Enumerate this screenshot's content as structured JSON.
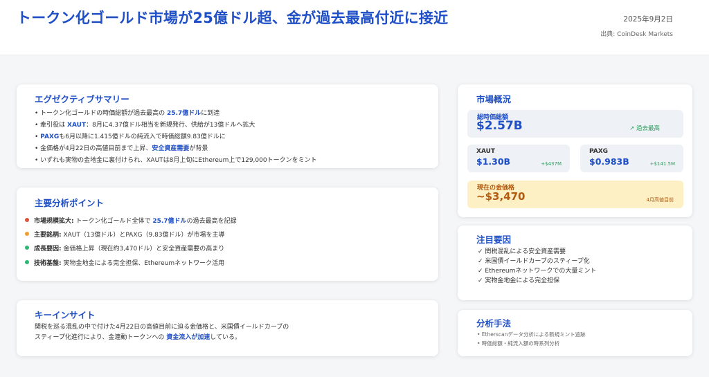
{
  "header": {
    "title": "トークン化ゴールド市場が25億ドル超、金が過去最高付近に接近",
    "date": "2025年9月2日",
    "source": "出典: CoinDesk Markets"
  },
  "summary": {
    "title": "エグゼクティブサマリー",
    "b1_pre": "• トークン化ゴールドの時価総額が過去最高の ",
    "b1_hl": "25.7億ドル",
    "b1_post": "に到達",
    "b2_pre": "• 牽引役は ",
    "b2_hl": "XAUT",
    "b2_post": "：8月に4.37億ドル相当を新規発行、供給が13億ドルへ拡大",
    "b3_pre": "• ",
    "b3_hl": "PAXG",
    "b3_post": "も6月以降に1.415億ドルの純流入で時価総額9.83億ドルに",
    "b4_pre": "• 金価格が4月22日の高値目前まで上昇、",
    "b4_hl": "安全資産需要",
    "b4_post": "が背景",
    "b5": "• いずれも実物の金地金に裏付けられ、XAUTは8月上旬にEthereum上で129,000トークンをミント"
  },
  "analysis": {
    "title": "主要分析ポイント",
    "p1_label": "市場規模拡大:",
    "p1_pre": " トークン化ゴールド全体で ",
    "p1_hl": "25.7億ドル",
    "p1_post": "の過去最高を記録",
    "p2_label": "主要銘柄:",
    "p2_text": " XAUT（13億ドル）とPAXG（9.83億ドル）が市場を主導",
    "p3_label": "成長要因:",
    "p3_text": " 金価格上昇（現在約3,470ドル）と安全資産需要の高まり",
    "p4_label": "技術基盤:",
    "p4_text": " 実物金地金による完全担保、Ethereumネットワーク活用",
    "dot_colors": [
      "#e0533c",
      "#f0a030",
      "#2eb872",
      "#2eb872"
    ]
  },
  "insight": {
    "title": "キーインサイト",
    "line1": "関税を巡る混乱の中で付けた4月22日の高値目前に迫る金価格と、米国債イールドカーブの",
    "line2_pre": "スティープ化進行により、金連動トークンへの ",
    "line2_hl": "資金流入が加速",
    "line2_post": "している。"
  },
  "market": {
    "title": "市場概況",
    "total_label": "総時価総額",
    "total_value": "$2.57B",
    "total_badge": "↗ 過去最高",
    "xaut_label": "XAUT",
    "xaut_value": "$1.30B",
    "xaut_change": "+$437M",
    "paxg_label": "PAXG",
    "paxg_value": "$0.983B",
    "paxg_change": "+$141.5M",
    "gold_label": "現在の金価格",
    "gold_value": "~$3,470",
    "gold_note": "4月高値目前"
  },
  "factors": {
    "title": "注目要因",
    "items": [
      "✓ 関税混乱による安全資産需要",
      "✓ 米国債イールドカーブのスティープ化",
      "✓ Ethereumネットワークでの大量ミント",
      "✓ 実物金地金による完全担保"
    ]
  },
  "method": {
    "title": "分析手法",
    "items": [
      "• Etherscanデータ分析による新規ミント追跡",
      "• 時価総額・純流入額の時系列分析"
    ]
  },
  "colors": {
    "accent": "#1f4fc6",
    "positive": "#2e9e5e",
    "gold_bg": "#fdf0c4",
    "gold_text": "#b3590e"
  }
}
